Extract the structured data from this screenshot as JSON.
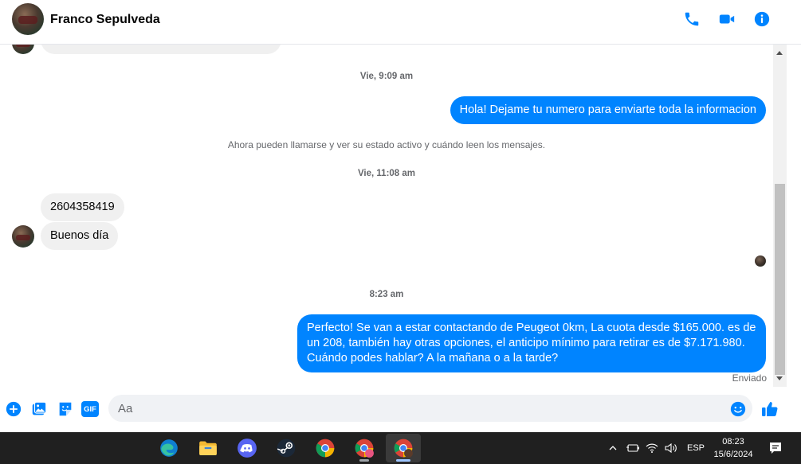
{
  "header": {
    "contact_name": "Franco Sepulveda",
    "icons": [
      "phone-icon",
      "video-camera-icon",
      "info-icon"
    ],
    "accent_color": "#0084ff"
  },
  "chat": {
    "items": [
      {
        "kind": "timestamp",
        "text": "Vie, 9:09 am"
      },
      {
        "kind": "outgoing",
        "text": "Hola! Dejame tu numero para enviarte toda la informacion"
      },
      {
        "kind": "system",
        "text": "Ahora pueden llamarse y ver su estado activo y cuándo leen los mensajes."
      },
      {
        "kind": "timestamp",
        "text": "Vie, 11:08 am"
      },
      {
        "kind": "incoming",
        "text": "2604358419"
      },
      {
        "kind": "incoming",
        "text": "Buenos día"
      },
      {
        "kind": "timestamp",
        "text": "8:23 am"
      },
      {
        "kind": "outgoing",
        "text": "Perfecto!  Se van a estar contactando de Peugeot 0km, La cuota desde $165.000. es de un 208, también hay otras opciones, el anticipo mínimo para retirar es de $7.171.980. Cuándo podes hablar? A la mañana o a la tarde?"
      }
    ],
    "sent_status": "Enviado"
  },
  "composer": {
    "placeholder": "Aa",
    "gif_label": "GIF",
    "icons": [
      "plus-icon",
      "image-icon",
      "sticker-icon",
      "gif-icon",
      "emoji-icon",
      "thumbs-up-icon"
    ]
  },
  "taskbar": {
    "apps": [
      "edge-icon",
      "file-explorer-icon",
      "discord-icon",
      "steam-icon",
      "chrome-icon",
      "chrome-profile-icon",
      "chrome-profile-active-icon"
    ],
    "language": "ESP",
    "time": "08:23",
    "date": "15/6/2024"
  }
}
